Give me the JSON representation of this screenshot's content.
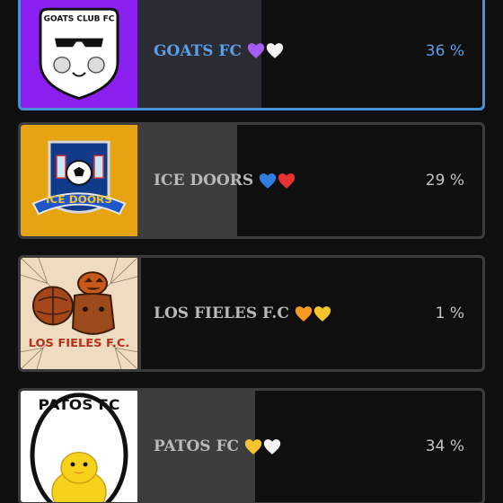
{
  "poll": {
    "options": [
      {
        "name": "GOATS FC",
        "percent_label": "36 %",
        "percent": 36,
        "selected": true,
        "logo_text": "GOATS CLUB FC",
        "hearts": [
          "purple-heart",
          "white-heart"
        ],
        "heart_colors": [
          "#a55cf0",
          "#f2f2f2"
        ]
      },
      {
        "name": "ICE DOORS",
        "percent_label": "29 %",
        "percent": 29,
        "selected": false,
        "logo_text": "ICE DOORS",
        "hearts": [
          "blue-heart",
          "red-heart"
        ],
        "heart_colors": [
          "#2f7de0",
          "#e63232"
        ]
      },
      {
        "name": "LOS FIELES F.C",
        "percent_label": "1 %",
        "percent": 1,
        "selected": false,
        "logo_text": "LOS FIELES F.C.",
        "hearts": [
          "orange-heart",
          "yellow-heart"
        ],
        "heart_colors": [
          "#f59a1f",
          "#f7c52b"
        ]
      },
      {
        "name": "PATOS FC",
        "percent_label": "34 %",
        "percent": 34,
        "selected": false,
        "logo_text": "PATOS FC",
        "hearts": [
          "yellow-heart",
          "white-heart"
        ],
        "heart_colors": [
          "#f7c52b",
          "#f2f2f2"
        ]
      }
    ]
  },
  "colors": {
    "selected_border": "#4a90d9",
    "selected_text": "#5b9ee6",
    "card_border": "#3c3c3c",
    "background": "#0f0f0f"
  }
}
